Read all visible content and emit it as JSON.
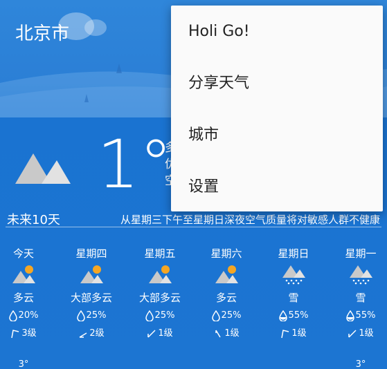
{
  "location": {
    "city": "北京市"
  },
  "current": {
    "temperature": "1°",
    "side_lines": [
      "多",
      "优",
      "空"
    ],
    "icon": "cloudy-mountains-icon"
  },
  "forecast": {
    "title": "未来10天",
    "note": "从星期三下午至星期日深夜空气质量将对敏感人群不健康",
    "days": [
      {
        "name": "今天",
        "icon": "partly-cloudy-icon",
        "condition": "多云",
        "precip": "20%",
        "wind": "3级",
        "low": "3°"
      },
      {
        "name": "星期四",
        "icon": "partly-cloudy-icon",
        "condition": "大部多云",
        "precip": "25%",
        "wind": "2级",
        "low": ""
      },
      {
        "name": "星期五",
        "icon": "partly-cloudy-icon",
        "condition": "大部多云",
        "precip": "25%",
        "wind": "1级",
        "low": ""
      },
      {
        "name": "星期六",
        "icon": "partly-cloudy-icon",
        "condition": "多云",
        "precip": "25%",
        "wind": "1级",
        "low": ""
      },
      {
        "name": "星期日",
        "icon": "snow-icon",
        "condition": "雪",
        "precip": "55%",
        "wind": "1级",
        "low": ""
      },
      {
        "name": "星期一",
        "icon": "snow-icon",
        "condition": "雪",
        "precip": "55%",
        "wind": "1级",
        "low": "3°"
      }
    ]
  },
  "menu": {
    "items": [
      {
        "label": "Holi Go!"
      },
      {
        "label": "分享天气"
      },
      {
        "label": "城市"
      },
      {
        "label": "设置"
      }
    ]
  },
  "colors": {
    "background": "#1a74d2",
    "menu_bg": "#fafafa",
    "sun": "#f5a623"
  }
}
